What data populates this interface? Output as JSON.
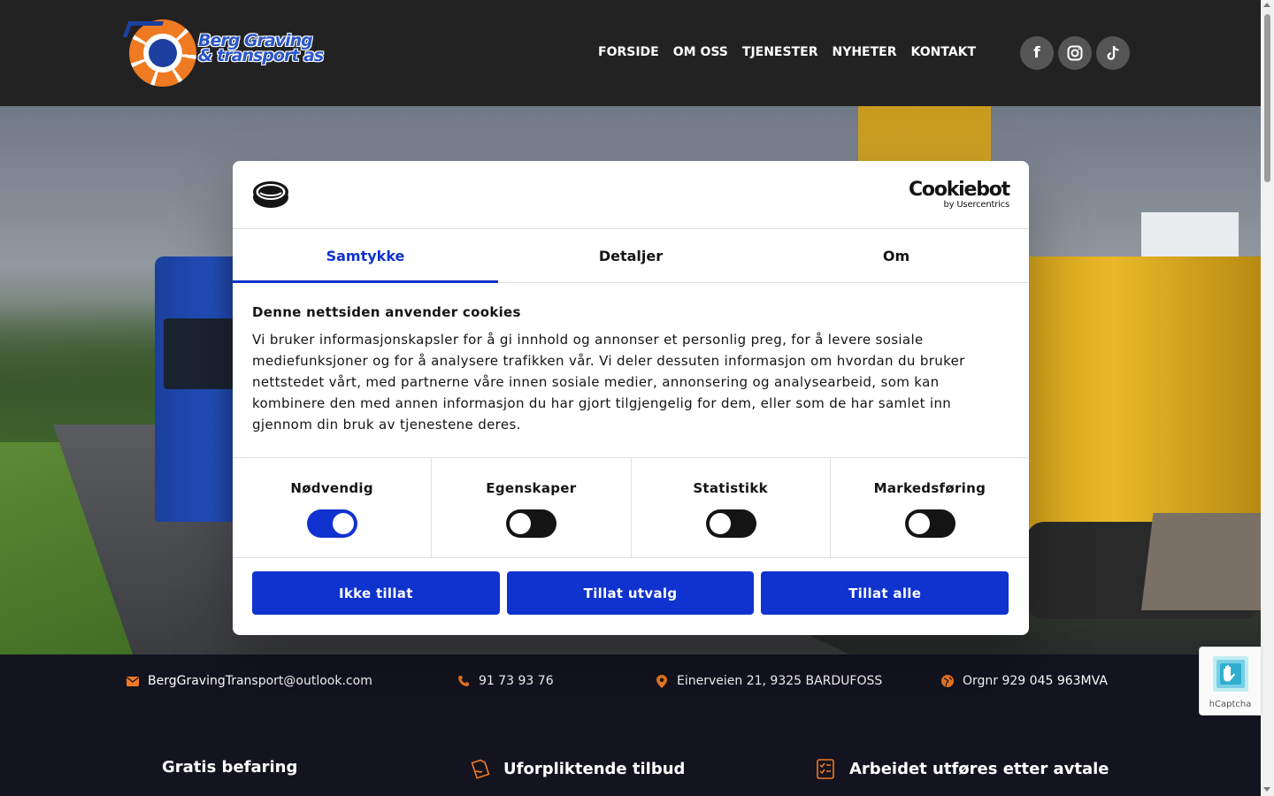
{
  "header": {
    "logo_text_line1": "Berg Graving",
    "logo_text_line2": "& transport as",
    "nav": [
      "FORSIDE",
      "OM OSS",
      "TJENESTER",
      "NYHETER",
      "KONTAKT"
    ],
    "social": [
      {
        "icon": "facebook-icon",
        "glyph": "f"
      },
      {
        "icon": "instagram-icon",
        "glyph": "◎"
      },
      {
        "icon": "tiktok-icon",
        "glyph": "♪"
      }
    ]
  },
  "info_bar": {
    "email": "BergGravingTransport@outlook.com",
    "phone": "91 73 93 76",
    "address": "Einerveien 21, 9325 BARDUFOSS",
    "orgnr": "Orgnr 929 045 963MVA"
  },
  "features": {
    "items": [
      "Gratis befaring",
      "Uforpliktende tilbud",
      "Arbeidet utføres etter avtale"
    ]
  },
  "cookie_dialog": {
    "brand": "Cookiebot",
    "brand_sub": "by Usercentrics",
    "tabs": [
      "Samtykke",
      "Detaljer",
      "Om"
    ],
    "active_tab": "Samtykke",
    "title": "Denne nettsiden anvender cookies",
    "text": "Vi bruker informasjonskapsler for å gi innhold og annonser et personlig preg, for å levere sosiale mediefunksjoner og for å analysere trafikken vår. Vi deler dessuten informasjon om hvordan du bruker nettstedet vårt, med partnerne våre innen sosiale medier, annonsering og analysearbeid, som kan kombinere den med annen informasjon du har gjort tilgjengelig for dem, eller som de har samlet inn gjennom din bruk av tjenestene deres.",
    "toggles": [
      {
        "label": "Nødvendig",
        "on": true
      },
      {
        "label": "Egenskaper",
        "on": false
      },
      {
        "label": "Statistikk",
        "on": false
      },
      {
        "label": "Markedsføring",
        "on": false
      }
    ],
    "buttons": {
      "deny": "Ikke tillat",
      "allow_selection": "Tillat utvalg",
      "allow_all": "Tillat alle"
    }
  },
  "hcaptcha": {
    "label": "hCaptcha"
  },
  "colors": {
    "accent": "#1032cf",
    "orange": "#f07a22",
    "header_bg": "#222222",
    "footer_bg": "#141420"
  }
}
